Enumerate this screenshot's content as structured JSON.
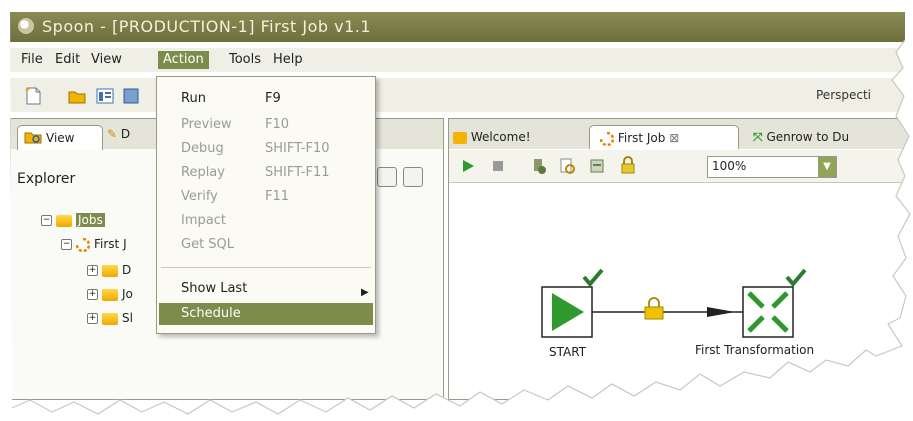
{
  "window": {
    "title": "Spoon - [PRODUCTION-1] First Job v1.1"
  },
  "menubar": {
    "items": [
      "File",
      "Edit",
      "View",
      "Action",
      "Tools",
      "Help"
    ],
    "active": "Action"
  },
  "toolbar": {
    "perspective_label": "Perspecti"
  },
  "action_menu": {
    "items": [
      {
        "label": "Run",
        "shortcut": "F9",
        "enabled": true
      },
      {
        "label": "Preview",
        "shortcut": "F10",
        "enabled": false
      },
      {
        "label": "Debug",
        "shortcut": "SHIFT-F10",
        "enabled": false
      },
      {
        "label": "Replay",
        "shortcut": "SHIFT-F11",
        "enabled": false
      },
      {
        "label": "Verify",
        "shortcut": "F11",
        "enabled": false
      },
      {
        "label": "Impact",
        "shortcut": "",
        "enabled": false
      },
      {
        "label": "Get SQL",
        "shortcut": "",
        "enabled": false
      },
      {
        "label": "Show Last",
        "shortcut": "",
        "enabled": true,
        "submenu": true
      },
      {
        "label": "Schedule",
        "shortcut": "",
        "enabled": true,
        "highlighted": true
      }
    ]
  },
  "left_panel": {
    "tabs": [
      "View",
      "D"
    ],
    "explorer_label": "Explorer",
    "tree": [
      {
        "label": "Jobs",
        "selected": true
      },
      {
        "label": "First J"
      },
      {
        "label": "D"
      },
      {
        "label": "Jo"
      },
      {
        "label": "Sl"
      }
    ]
  },
  "right_panel": {
    "tabs": [
      {
        "label": "Welcome!"
      },
      {
        "label": "First Job",
        "active": true,
        "close": "⊠"
      },
      {
        "label": "Genrow to Du"
      }
    ],
    "zoom": "100%",
    "nodes": [
      {
        "label": "START"
      },
      {
        "label": "First Transformation"
      }
    ]
  },
  "colors": {
    "accent": "#7d8c4b",
    "title_bar": "#7a7a48",
    "hop_green": "#2e9a2e"
  }
}
